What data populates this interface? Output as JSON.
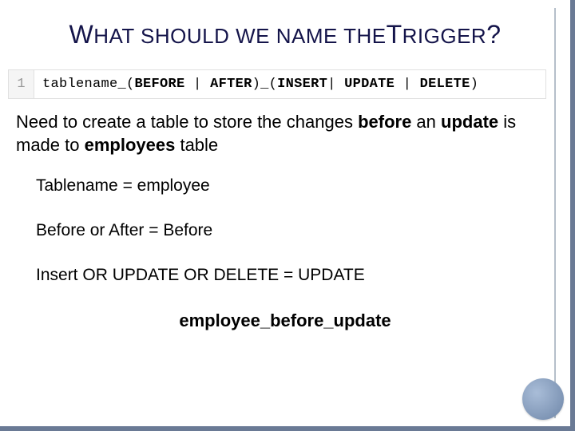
{
  "title_parts": {
    "p1": "W",
    "p2": "HAT SHOULD WE NAME THE",
    "p3": "T",
    "p4": "RIGGER",
    "p5": "?"
  },
  "code": {
    "lineno": "1",
    "prefix": "tablename_(",
    "before": "BEFORE",
    "sep1": " | ",
    "after": "AFTER",
    "mid": ")_(",
    "insert": "INSERT",
    "sep2": "| ",
    "update": "UPDATE",
    "sep3": " | ",
    "delete": "DELETE",
    "suffix": ")"
  },
  "desc": {
    "t1": "Need to create a table to store the changes ",
    "b1": "before",
    "t2": " an ",
    "b2": "update",
    "t3": " is made to ",
    "b3": "employees",
    "t4": " table"
  },
  "answers": {
    "a1": "Tablename = employee",
    "a2": "Before or After = Before",
    "a3": "Insert OR UPDATE OR DELETE = UPDATE"
  },
  "result": "employee_before_update"
}
